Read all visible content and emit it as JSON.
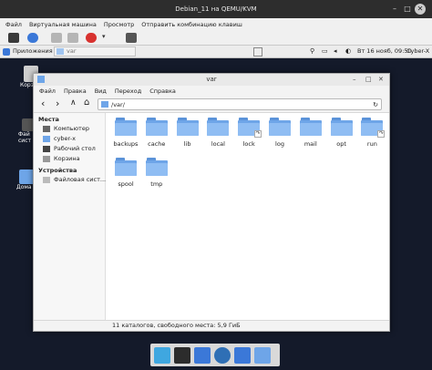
{
  "host": {
    "title": "Debian_11 на QEMU/KVM",
    "menu": [
      "Файл",
      "Виртуальная машина",
      "Просмотр",
      "Отправить комбинацию клавиш"
    ]
  },
  "xfce_panel": {
    "apps_label": "Приложения",
    "tab_label": "var",
    "datetime": "Вт 16 нояб, 09:50",
    "user": "Cyber-X"
  },
  "desktop": {
    "icons": [
      "Корз",
      "Фай сист",
      "Дома"
    ]
  },
  "file_manager": {
    "title": "var",
    "menu": [
      "Файл",
      "Правка",
      "Вид",
      "Переход",
      "Справка"
    ],
    "path": "/var/",
    "sidebar": {
      "places_title": "Места",
      "places": [
        "Компьютер",
        "cyber-x",
        "Рабочий стол",
        "Корзина"
      ],
      "devices_title": "Устройства",
      "devices": [
        "Файловая сист..."
      ]
    },
    "folders": [
      {
        "name": "backups",
        "link": false
      },
      {
        "name": "cache",
        "link": false
      },
      {
        "name": "lib",
        "link": false
      },
      {
        "name": "local",
        "link": false
      },
      {
        "name": "lock",
        "link": true
      },
      {
        "name": "log",
        "link": false
      },
      {
        "name": "mail",
        "link": false
      },
      {
        "name": "opt",
        "link": false
      },
      {
        "name": "run",
        "link": true
      },
      {
        "name": "spool",
        "link": false
      },
      {
        "name": "tmp",
        "link": false
      }
    ],
    "status": "11 каталогов, свободного места: 5,9 ГиБ"
  },
  "colors": {
    "folder": "#6ea5e8",
    "desktop_bg": "#141a2a"
  }
}
